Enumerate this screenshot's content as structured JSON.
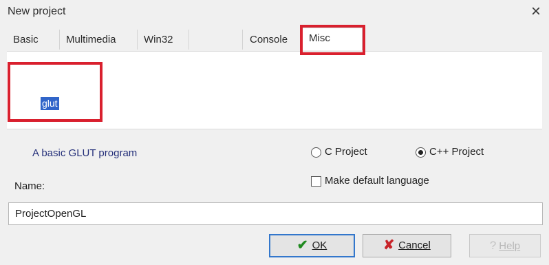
{
  "window": {
    "title": "New project",
    "close_glyph": "×"
  },
  "tabs": [
    {
      "label": "Basic",
      "active": false
    },
    {
      "label": "Multimedia",
      "active": false
    },
    {
      "label": "Win32",
      "active": false
    },
    {
      "label": "",
      "active": false
    },
    {
      "label": "Console",
      "active": false
    },
    {
      "label": "Misc",
      "active": true
    }
  ],
  "templates": [
    {
      "label": "glut",
      "selected": true
    }
  ],
  "description": "A basic GLUT program",
  "language": {
    "c_label": "C Project",
    "cpp_label": "C++ Project",
    "selected": "C++ Project",
    "default_label": "Make default language",
    "default_checked": false
  },
  "name": {
    "label": "Name:",
    "value": "ProjectOpenGL"
  },
  "buttons": {
    "ok": "OK",
    "cancel": "Cancel",
    "help": "Help"
  },
  "colors": {
    "highlight": "#d9202e",
    "selection": "#3165c9",
    "description": "#25307a"
  },
  "icons": {
    "ok": "checkmark-icon",
    "cancel": "x-icon",
    "help": "question-icon"
  }
}
